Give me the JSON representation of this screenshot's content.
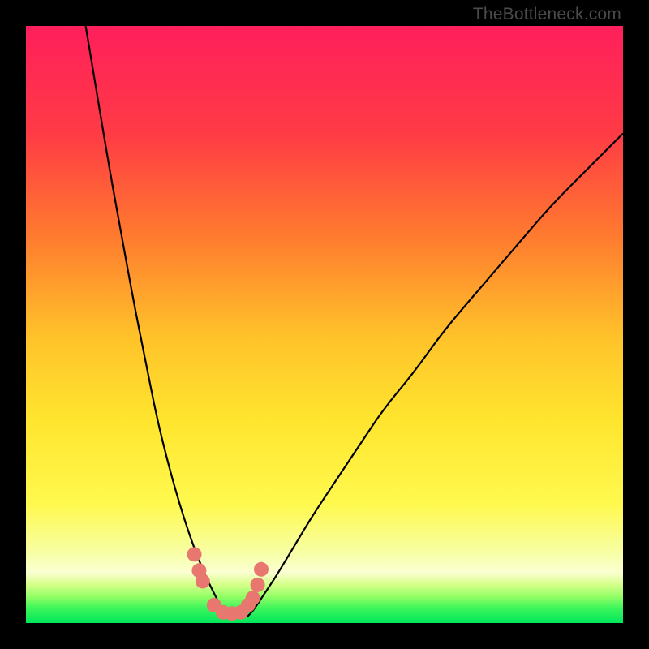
{
  "watermark": "TheBottleneck.com",
  "colors": {
    "black": "#000000",
    "curve": "#000000",
    "marker": "#e8776f",
    "green": "#00e85c",
    "yellow_green": "#bfff5a",
    "pale_yellow": "#faffb0",
    "yellow": "#ffe52e",
    "orange": "#ff9a2a",
    "orange_red": "#ff642e",
    "red": "#ff2a4a",
    "magenta_red": "#ff1f5c"
  },
  "chart_data": {
    "type": "line",
    "title": "",
    "xlabel": "",
    "ylabel": "",
    "xlim": [
      0,
      100
    ],
    "ylim": [
      0,
      100
    ],
    "series": [
      {
        "name": "left-curve",
        "x": [
          10,
          12,
          14,
          16,
          18,
          20,
          22,
          24,
          26,
          28,
          30,
          32,
          33,
          34
        ],
        "y": [
          100,
          88,
          76,
          65,
          54,
          44,
          34,
          26,
          19,
          13,
          8,
          4,
          2,
          1
        ]
      },
      {
        "name": "right-curve",
        "x": [
          37,
          38,
          40,
          42,
          45,
          48,
          52,
          56,
          60,
          65,
          70,
          76,
          82,
          88,
          94,
          100
        ],
        "y": [
          1,
          2,
          5,
          8,
          13,
          18,
          24,
          30,
          36,
          42,
          49,
          56,
          63,
          70,
          76,
          82
        ]
      },
      {
        "name": "green-floor",
        "x": [
          0,
          100
        ],
        "y": [
          1.5,
          1.5
        ]
      }
    ],
    "markers": {
      "name": "highlighted-points",
      "x": [
        28.2,
        29.0,
        29.6,
        31.5,
        33.0,
        34.5,
        36.0,
        37.2,
        38.0,
        38.8,
        39.4
      ],
      "y": [
        11.5,
        8.8,
        7.0,
        3.0,
        1.8,
        1.6,
        1.8,
        3.0,
        4.2,
        6.4,
        9.0
      ]
    },
    "background_gradient": {
      "stops": [
        {
          "pos": 0.0,
          "color": "#ff1f5c"
        },
        {
          "pos": 0.18,
          "color": "#ff3b45"
        },
        {
          "pos": 0.35,
          "color": "#ff7a2f"
        },
        {
          "pos": 0.52,
          "color": "#ffc22a"
        },
        {
          "pos": 0.66,
          "color": "#ffe52e"
        },
        {
          "pos": 0.8,
          "color": "#fff94e"
        },
        {
          "pos": 0.885,
          "color": "#f7ffa8"
        },
        {
          "pos": 0.915,
          "color": "#fbffd2"
        },
        {
          "pos": 0.935,
          "color": "#d6ff8a"
        },
        {
          "pos": 0.955,
          "color": "#96ff66"
        },
        {
          "pos": 0.975,
          "color": "#3cf55a"
        },
        {
          "pos": 1.0,
          "color": "#00e85c"
        }
      ]
    }
  }
}
